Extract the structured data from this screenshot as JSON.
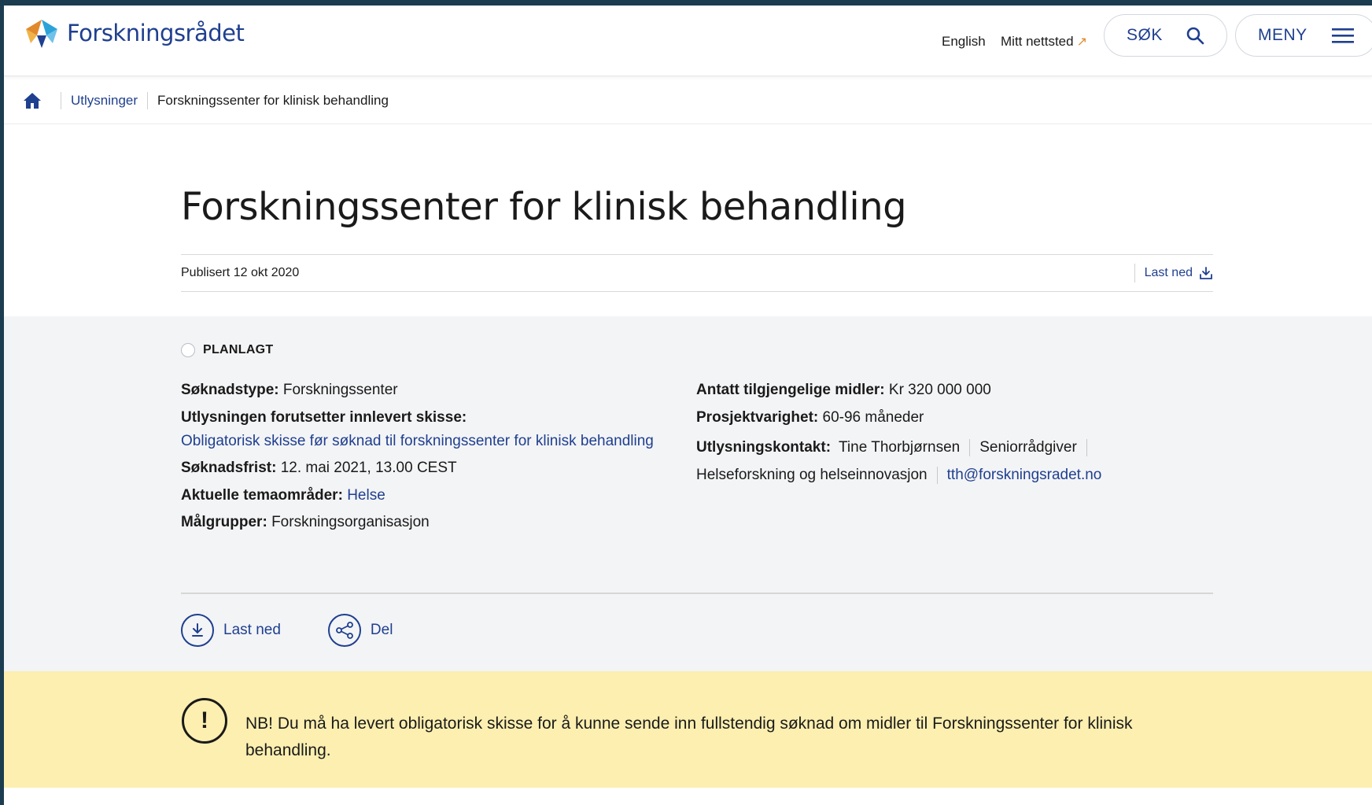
{
  "header": {
    "logo_text": "Forskningsrådet",
    "english": "English",
    "mitt_nettsted": "Mitt nettsted",
    "search_label": "SØK",
    "menu_label": "MENY"
  },
  "breadcrumb": {
    "items": [
      "Utlysninger",
      "Forskningssenter for klinisk behandling"
    ]
  },
  "page": {
    "title": "Forskningssenter for klinisk behandling",
    "published": "Publisert 12 okt 2020",
    "download": "Last ned"
  },
  "info": {
    "status": "PLANLAGT",
    "left": {
      "soknadstype_label": "Søknadstype:",
      "soknadstype_value": "Forskningssenter",
      "skisse_label": "Utlysningen forutsetter innlevert skisse:",
      "skisse_link": "Obligatorisk skisse før søknad til forskningssenter for klinisk behandling",
      "frist_label": "Søknadsfrist:",
      "frist_value": "12. mai 2021, 13.00 CEST",
      "tema_label": "Aktuelle temaområder:",
      "tema_value": "Helse",
      "malgrupper_label": "Målgrupper:",
      "malgrupper_value": "Forskningsorganisasjon"
    },
    "right": {
      "midler_label": "Antatt tilgjengelige midler:",
      "midler_value": "Kr 320 000 000",
      "varighet_label": "Prosjektvarighet:",
      "varighet_value": "60-96 måneder",
      "kontakt_label": "Utlysningskontakt:",
      "kontakt_name": "Tine Thorbjørnsen",
      "kontakt_title": "Seniorrådgiver",
      "kontakt_dept": "Helseforskning og helseinnovasjon",
      "kontakt_email": "tth@forskningsradet.no"
    },
    "actions": {
      "download": "Last ned",
      "share": "Del"
    }
  },
  "notice": {
    "icon": "!",
    "text": "NB! Du må ha levert obligatorisk skisse for å kunne sende inn fullstendig søknad om midler til Forskningssenter for klinisk behandling."
  },
  "colors": {
    "brand_blue": "#1f3f8f",
    "notice_bg": "#fcefb0",
    "info_bg": "#f3f4f6"
  }
}
